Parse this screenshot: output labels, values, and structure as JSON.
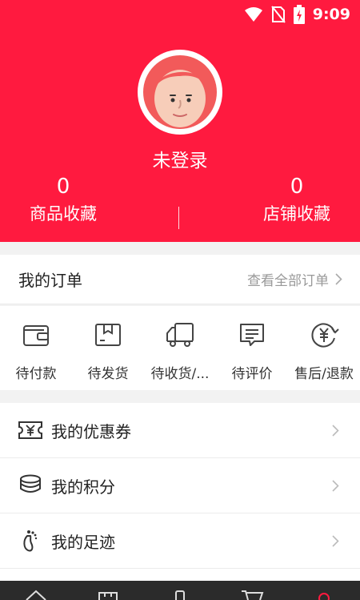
{
  "status_bar": {
    "time": "9:09"
  },
  "profile": {
    "login_text": "未登录",
    "stats": [
      {
        "count": "0",
        "label": "商品收藏"
      },
      {
        "count": "0",
        "label": "店铺收藏"
      }
    ]
  },
  "orders": {
    "title": "我的订单",
    "view_all": "查看全部订单",
    "items": [
      {
        "label": "待付款",
        "icon": "wallet-icon"
      },
      {
        "label": "待发货",
        "icon": "box-icon"
      },
      {
        "label": "待收货/...",
        "icon": "truck-icon"
      },
      {
        "label": "待评价",
        "icon": "comment-icon"
      },
      {
        "label": "售后/退款",
        "icon": "refund-icon"
      }
    ]
  },
  "menu": {
    "items": [
      {
        "label": "我的优惠券",
        "icon": "coupon-icon"
      },
      {
        "label": "我的积分",
        "icon": "points-icon"
      },
      {
        "label": "我的足迹",
        "icon": "footprint-icon"
      }
    ]
  },
  "colors": {
    "brand_red": "#ff1a3f",
    "bottom_bar": "#2b2b2b"
  }
}
